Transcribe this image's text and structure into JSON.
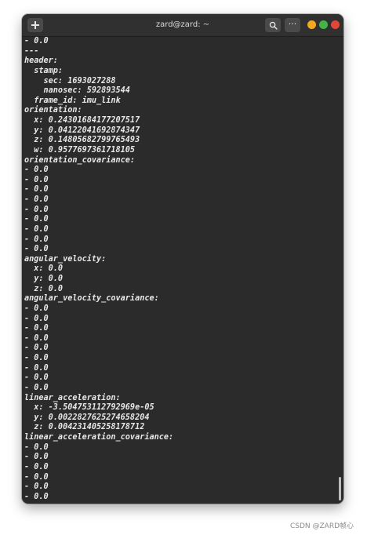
{
  "window": {
    "title": "zard@zard: ~",
    "new_tab_icon": "plus-icon",
    "search_icon": "search-icon",
    "menu_icon": "more-horizontal-icon",
    "menu_glyph": "···",
    "colors": {
      "minimize": "#f5a623",
      "maximize": "#43b34a",
      "close": "#e0463a"
    }
  },
  "terminal": {
    "lines": [
      "- 0.0",
      "---",
      "header:",
      "  stamp:",
      "    sec: 1693027288",
      "    nanosec: 592893544",
      "  frame_id: imu_link",
      "orientation:",
      "  x: 0.24301684177207517",
      "  y: 0.04122041692874347",
      "  z: 0.14805682799765493",
      "  w: 0.9577697361718105",
      "orientation_covariance:",
      "- 0.0",
      "- 0.0",
      "- 0.0",
      "- 0.0",
      "- 0.0",
      "- 0.0",
      "- 0.0",
      "- 0.0",
      "- 0.0",
      "angular_velocity:",
      "  x: 0.0",
      "  y: 0.0",
      "  z: 0.0",
      "angular_velocity_covariance:",
      "- 0.0",
      "- 0.0",
      "- 0.0",
      "- 0.0",
      "- 0.0",
      "- 0.0",
      "- 0.0",
      "- 0.0",
      "- 0.0",
      "linear_acceleration:",
      "  x: -3.504753112792969e-05",
      "  y: 0.0022827625274658204",
      "  z: 0.004231405258178712",
      "linear_acceleration_covariance:",
      "- 0.0",
      "- 0.0",
      "- 0.0",
      "- 0.0",
      "- 0.0",
      "- 0.0"
    ]
  },
  "watermark": "CSDN @ZARD帧心"
}
